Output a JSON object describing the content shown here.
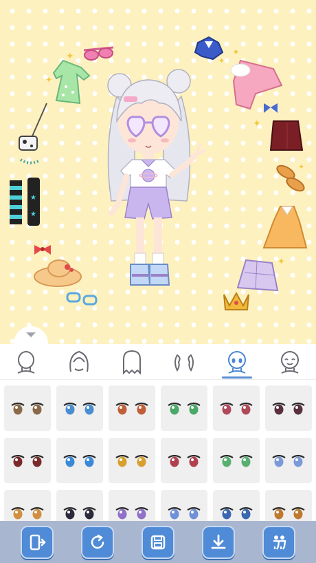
{
  "stage": {
    "background_color": "#fdf1c0",
    "dot_color": "#ffffff",
    "accessories": [
      "sunglasses-pink",
      "green-dress",
      "handbag",
      "pearl-necklace",
      "striped-socks",
      "bow",
      "sun-hat",
      "bracelets",
      "blue-top",
      "pink-jacket",
      "bow-tie",
      "red-skirt",
      "tan-shoes",
      "orange-dress",
      "plaid-skirt",
      "crown"
    ]
  },
  "character": {
    "hair_color": "#ececf2",
    "shirt_color": "#ffffff",
    "shorts_color": "#c9b6ef",
    "glasses_color": "#d8b7f0"
  },
  "categories": {
    "active_index": 4,
    "items": [
      {
        "icon": "head-icon"
      },
      {
        "icon": "hair-icon"
      },
      {
        "icon": "back-hair-icon"
      },
      {
        "icon": "side-hair-icon"
      },
      {
        "icon": "face-eyes-icon"
      },
      {
        "icon": "smiling-face-icon"
      }
    ]
  },
  "eye_swatches": {
    "colors": [
      "#8a6a48",
      "#4a8ed0",
      "#c0603a",
      "#4aa868",
      "#b04a5a",
      "#5a3040",
      "#7a2a2a",
      "#3a8ad8",
      "#d8a030",
      "#b04050",
      "#58b070",
      "#7a9ad8",
      "#d09040",
      "#2a2a3a",
      "#9070c8",
      "#7090d8",
      "#3a68b0",
      "#c07a30"
    ]
  },
  "toolbar": {
    "buttons": [
      {
        "icon": "exit-icon"
      },
      {
        "icon": "refresh-icon"
      },
      {
        "icon": "save-icon"
      },
      {
        "icon": "download-icon"
      },
      {
        "icon": "gallery-icon"
      }
    ],
    "accent": "#4f8bd6"
  }
}
